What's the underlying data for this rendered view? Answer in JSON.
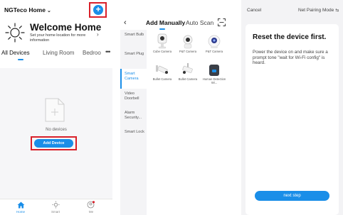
{
  "colors": {
    "accent": "#1a8ee8",
    "highlight": "#d9202a"
  },
  "panel1": {
    "home_name": "NGTeco Home",
    "welcome_title": "Welcome Home",
    "welcome_sub": "Set your home location for more information",
    "tabs": [
      "All Devices",
      "Living Room",
      "Bedroo"
    ],
    "no_devices": "No devices",
    "add_device": "Add Device",
    "nav": [
      "Home",
      "Smart",
      "Me"
    ]
  },
  "panel2": {
    "tabs": [
      "Add Manually",
      "Auto Scan"
    ],
    "categories": [
      "Smart Bulb",
      "Smart Plug",
      "Smart Camera",
      "Video Doorbell",
      "Alarm Security...",
      "Smart Lock"
    ],
    "devices": [
      "Cube Camera",
      "P&T Camera",
      "P&T Camera",
      "Bullet Camera",
      "Bullet Camera",
      "Human Detection Wi..."
    ]
  },
  "panel3": {
    "cancel": "Cancel",
    "mode": "Net Pairing Mode",
    "title": "Reset the device first.",
    "description": "Power the device on and make sure a prompt tone \"wait for Wi-Fi config\" is heard.",
    "next": "next step"
  }
}
